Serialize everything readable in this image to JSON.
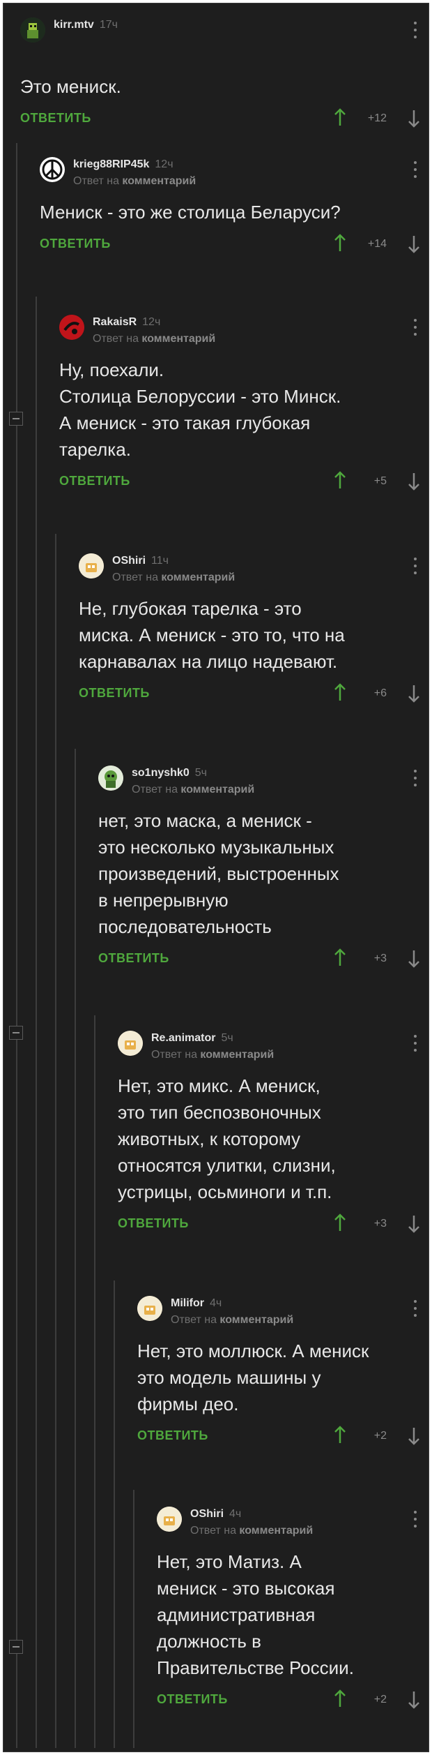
{
  "colors": {
    "background": "#1e1e1e",
    "accent": "#4fa83d",
    "text": "#e8e8e8",
    "muted": "#6f6f6f"
  },
  "reply_prefix": "Ответ на",
  "reply_target": "комментарий",
  "answer_label": "ОТВЕТИТЬ",
  "comments": [
    {
      "user": "kirr.mtv",
      "time": "17ч",
      "text": "Это мениск.",
      "rating": "+12",
      "is_reply": false,
      "avatar_icon": "pixel-character-avatar-icon"
    },
    {
      "user": "krieg88RIP45k",
      "time": "12ч",
      "text": "Мениск - это же столица Беларуси?",
      "rating": "+14",
      "is_reply": true,
      "avatar_icon": "peace-sign-avatar-icon"
    },
    {
      "user": "RakaisR",
      "time": "12ч",
      "text": "Ну, поехали.\nСтолица Белоруссии - это Минск.\nА мениск - это такая глубокая\nтарелка.",
      "rating": "+5",
      "is_reply": true,
      "avatar_icon": "red-logo-avatar-icon"
    },
    {
      "user": "OShiri",
      "time": "11ч",
      "text": "Не, глубокая тарелка - это\nмиска. А мениск - это то, что на\nкарнавалах на лицо надевают.",
      "rating": "+6",
      "is_reply": true,
      "avatar_icon": "default-avatar-icon"
    },
    {
      "user": "so1nyshk0",
      "time": "5ч",
      "text": "нет, это маска, а мениск -\nэто несколько музыкальных\nпроизведений, выстроенных\nв непрерывную\nпоследовательность",
      "rating": "+3",
      "is_reply": true,
      "avatar_icon": "green-character-avatar-icon"
    },
    {
      "user": "Re.animator",
      "time": "5ч",
      "text": "Нет, это микс. А мениск,\nэто тип беспозвоночных\nживотных, к которому\nотносятся улитки, слизни,\nустрицы, осьминоги и т.п.",
      "rating": "+3",
      "is_reply": true,
      "avatar_icon": "default-avatar-icon"
    },
    {
      "user": "Milifor",
      "time": "4ч",
      "text": "Нет, это моллюск. А мениск\nэто модель машины у\nфирмы део.",
      "rating": "+2",
      "is_reply": true,
      "avatar_icon": "default-avatar-icon"
    },
    {
      "user": "OShiri",
      "time": "4ч",
      "text": "Нет, это Матиз. А\nмениск - это высокая\nадминистративная\nдолжность в\nПравительстве России.",
      "rating": "+2",
      "is_reply": true,
      "avatar_icon": "default-avatar-icon"
    }
  ]
}
